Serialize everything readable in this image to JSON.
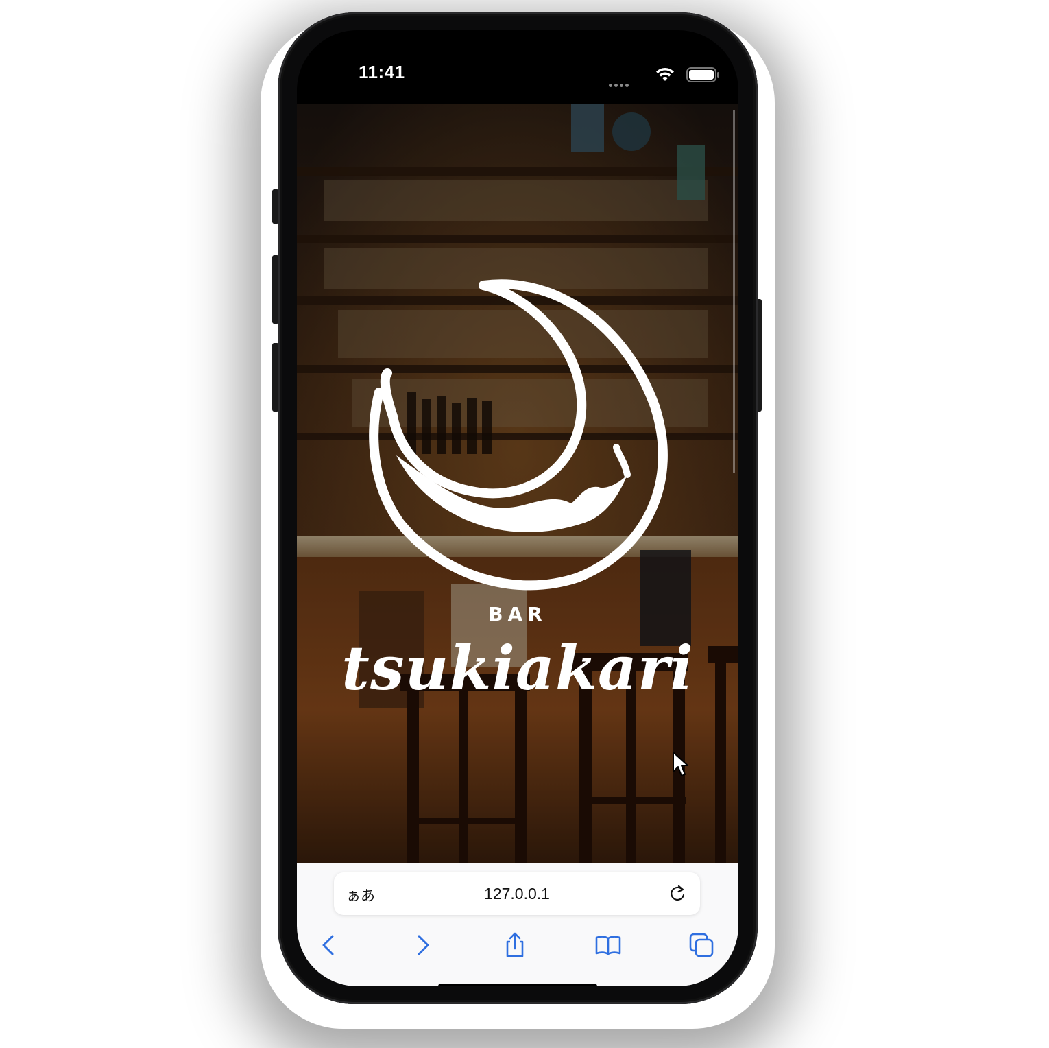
{
  "status_bar": {
    "time": "11:41",
    "wifi_icon": "wifi-icon",
    "battery_icon": "battery-icon"
  },
  "page": {
    "background_image": "bar-interior-photo",
    "logo_icon": "crescent-moon-logo",
    "brand_small": "BAR",
    "brand_big": "tsukiakari"
  },
  "safari": {
    "text_size_label": "ぁあ",
    "url": "127.0.0.1",
    "reload_icon": "reload-icon",
    "toolbar_icons": [
      "back-icon",
      "forward-icon",
      "share-icon",
      "bookmarks-icon",
      "tabs-icon"
    ]
  },
  "colors": {
    "accent": "#2f6fe0",
    "toolbar_bg": "#f9f9fa",
    "logo": "#ffffff"
  }
}
